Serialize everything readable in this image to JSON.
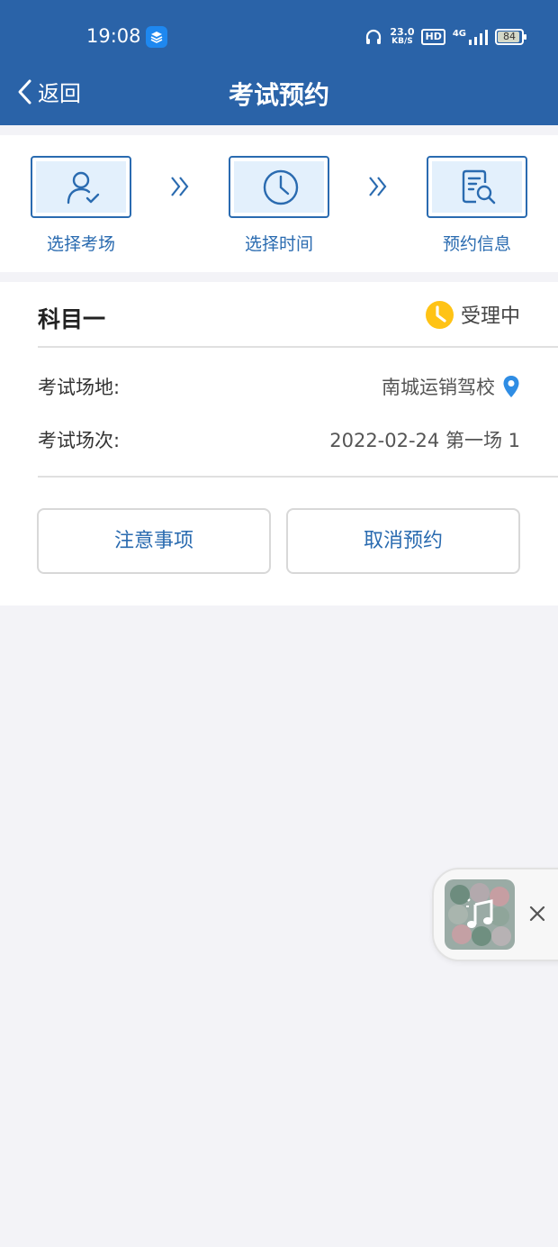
{
  "status_bar": {
    "time": "19:08",
    "speed_value": "23.0",
    "speed_unit": "KB/S",
    "hd": "HD",
    "network": "4G",
    "battery": "84"
  },
  "navbar": {
    "back_label": "返回",
    "title": "考试预约"
  },
  "steps": [
    {
      "label": "选择考场",
      "icon": "user-check-icon"
    },
    {
      "label": "选择时间",
      "icon": "clock-icon"
    },
    {
      "label": "预约信息",
      "icon": "document-search-icon"
    }
  ],
  "card": {
    "subject": "科目一",
    "status": "受理中",
    "location_label": "考试场地:",
    "location_value": "南城运销驾校",
    "session_label": "考试场次:",
    "session_value": "2022-02-24 第一场 1",
    "btn_notice": "注意事项",
    "btn_cancel": "取消预约"
  },
  "colors": {
    "header": "#2a63a8",
    "accent": "#2a6bb0",
    "status": "#ffc315",
    "background": "#f3f3f7"
  }
}
